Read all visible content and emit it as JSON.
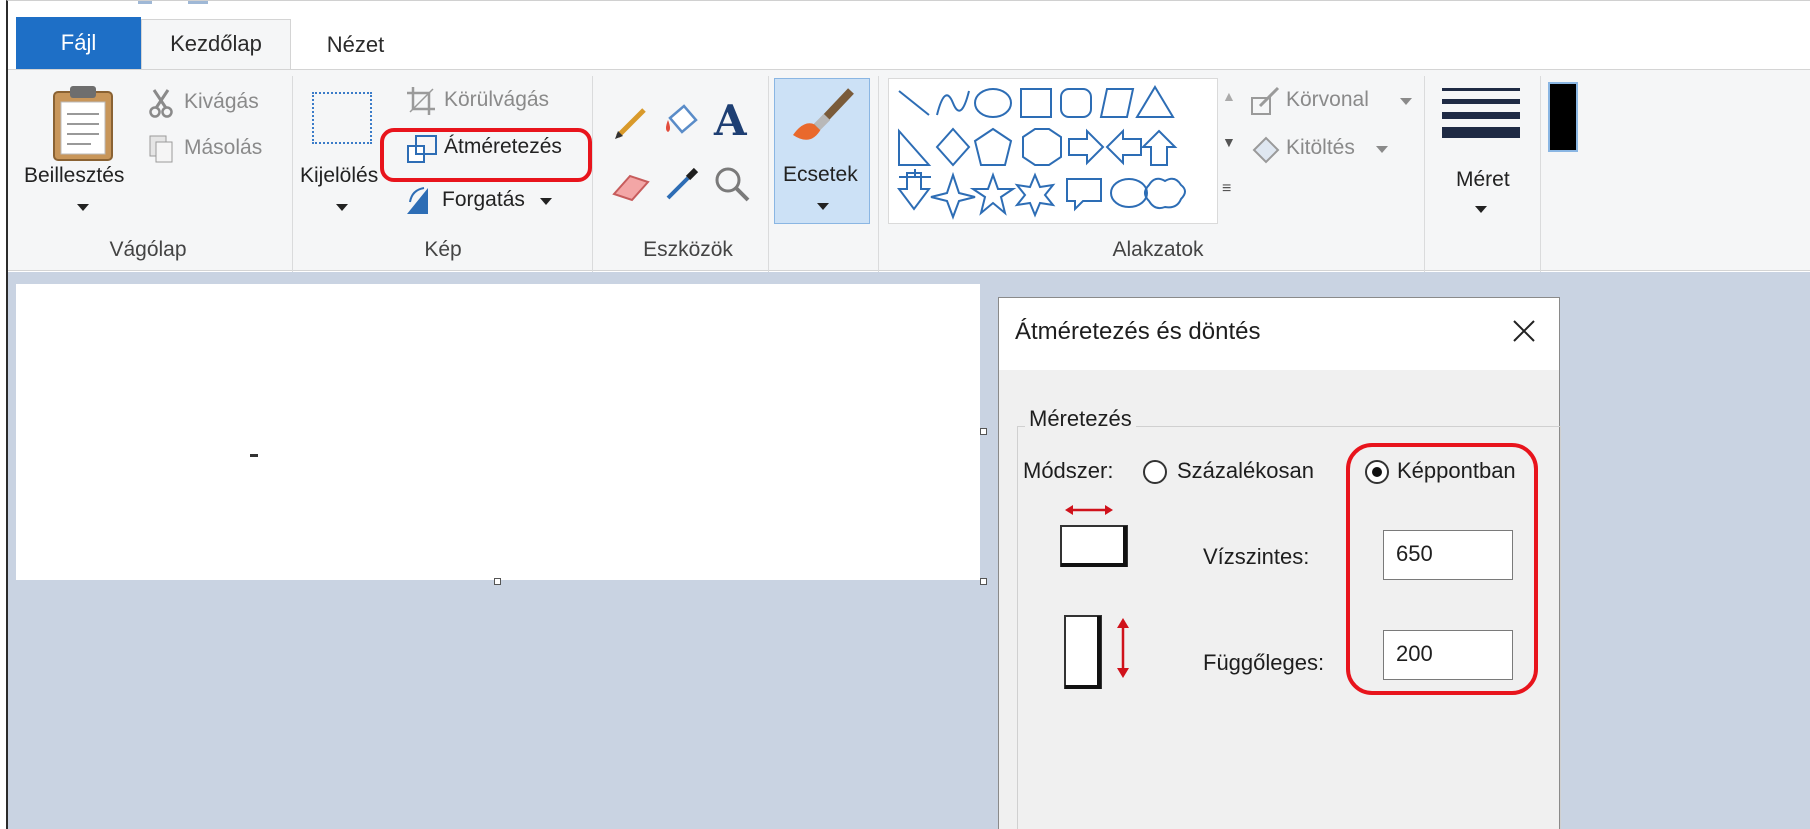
{
  "tabs": {
    "file": "Fájl",
    "home": "Kezdőlap",
    "view": "Nézet"
  },
  "clipboard": {
    "paste_label": "Beillesztés",
    "cut_label": "Kivágás",
    "copy_label": "Másolás",
    "group_label": "Vágólap"
  },
  "image": {
    "select_label": "Kijelölés",
    "crop_label": "Körülvágás",
    "resize_label": "Átméretezés",
    "rotate_label": "Forgatás",
    "group_label": "Kép"
  },
  "tools": {
    "group_label": "Eszközök"
  },
  "brushes": {
    "label": "Ecsetek"
  },
  "shapes": {
    "outline_label": "Körvonal",
    "fill_label": "Kitöltés",
    "group_label": "Alakzatok"
  },
  "size": {
    "label": "Méret"
  },
  "dialog": {
    "title": "Átméretezés és döntés",
    "section_label": "Méretezés",
    "method_label": "Módszer:",
    "option_percent": "Százalékosan",
    "option_pixels": "Képpontban",
    "selected_option": "Képpontban",
    "horizontal_label": "Vízszintes:",
    "horizontal_value": "650",
    "vertical_label": "Függőleges:",
    "vertical_value": "200"
  },
  "colors": {
    "accent": "#1e6fc6",
    "highlight": "#e8141c",
    "workspace": "#c9d3e2",
    "ribbon": "#f5f6f7"
  }
}
